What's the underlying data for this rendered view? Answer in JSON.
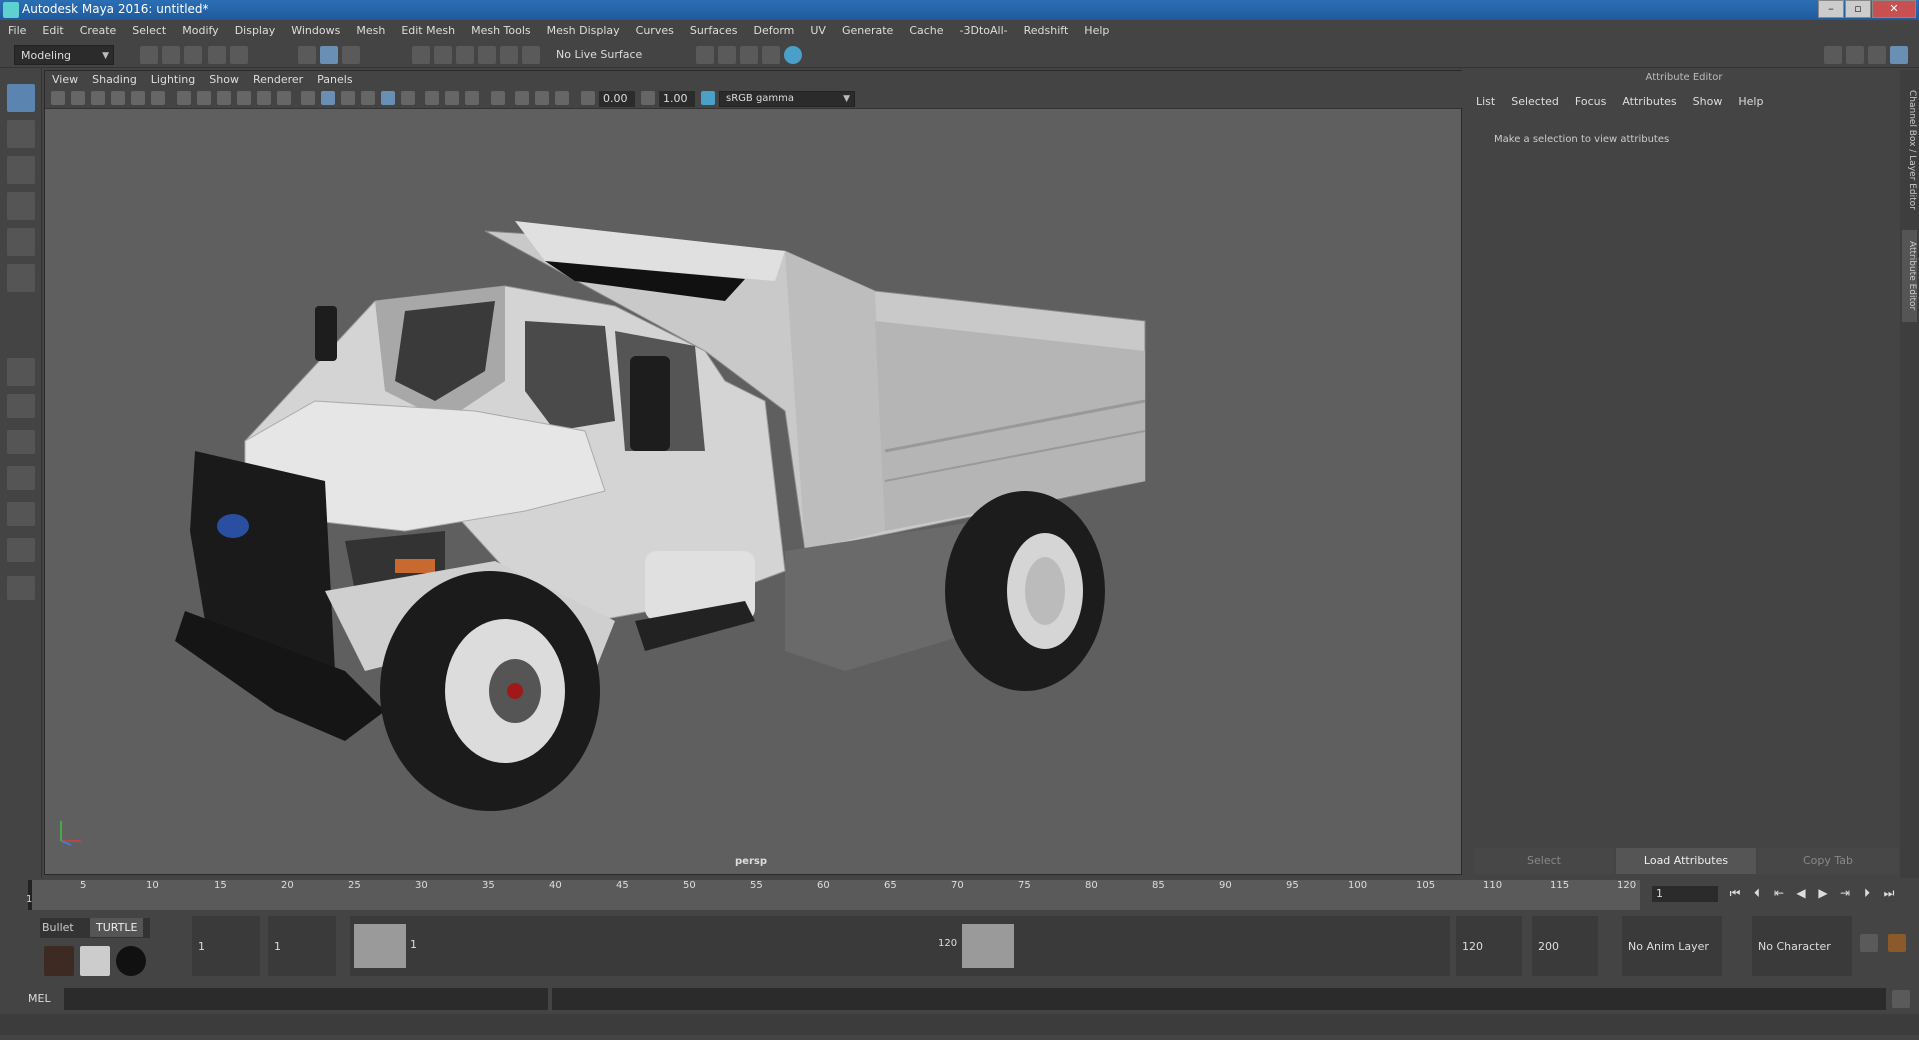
{
  "window": {
    "title": "Autodesk Maya 2016: untitled*"
  },
  "menus": [
    "File",
    "Edit",
    "Create",
    "Select",
    "Modify",
    "Display",
    "Windows",
    "Mesh",
    "Edit Mesh",
    "Mesh Tools",
    "Mesh Display",
    "Curves",
    "Surfaces",
    "Deform",
    "UV",
    "Generate",
    "Cache",
    "-3DtoAll-",
    "Redshift",
    "Help"
  ],
  "status": {
    "mode": "Modeling",
    "live_surface": "No Live Surface"
  },
  "viewport": {
    "menus": [
      "View",
      "Shading",
      "Lighting",
      "Show",
      "Renderer",
      "Panels"
    ],
    "exposure": "0.00",
    "gamma": "1.00",
    "color_space": "sRGB gamma",
    "camera": "persp"
  },
  "attribute_editor": {
    "title": "Attribute Editor",
    "menus": [
      "List",
      "Selected",
      "Focus",
      "Attributes",
      "Show",
      "Help"
    ],
    "message": "Make a selection to view attributes",
    "buttons": {
      "select": "Select",
      "load": "Load Attributes",
      "copy": "Copy Tab"
    }
  },
  "side_tabs": {
    "channel": "Channel Box / Layer Editor",
    "attr": "Attribute Editor"
  },
  "timeline": {
    "ticks": [
      "5",
      "10",
      "15",
      "20",
      "25",
      "30",
      "35",
      "40",
      "45",
      "50",
      "55",
      "60",
      "65",
      "70",
      "75",
      "80",
      "85",
      "90",
      "95",
      "100",
      "105",
      "110",
      "115",
      "120"
    ],
    "current_frame_label": "1",
    "current_frame": "1"
  },
  "range": {
    "start": "1",
    "playback_start": "1",
    "slider_start": "1",
    "slider_end": "120",
    "playback_end": "120",
    "end": "200",
    "anim_layer": "No Anim Layer",
    "character_set": "No Character Set"
  },
  "shelf": {
    "tab1": "Bullet",
    "tab2": "TURTLE"
  },
  "command": {
    "label": "MEL"
  },
  "colors": {
    "title_bar": "#2c6fb5",
    "accent": "#5b84b1",
    "viewport_bg": "#5f5f5f"
  }
}
